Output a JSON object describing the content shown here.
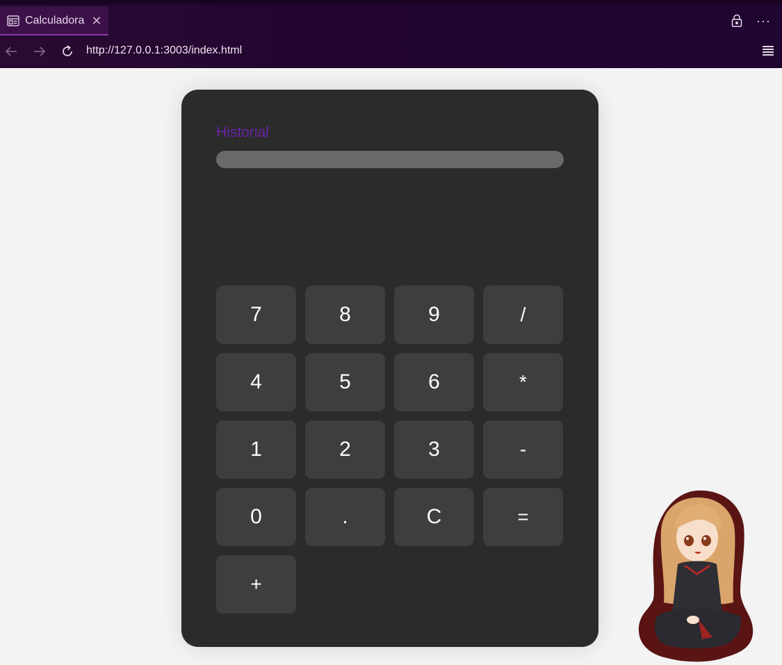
{
  "browser": {
    "tab_title": "Calculadora",
    "tab_close": "✕",
    "url": "http://127.0.0.1:3003/index.html",
    "more": "···"
  },
  "calculator": {
    "history_label": "Historial",
    "keys": [
      {
        "label": "7"
      },
      {
        "label": "8"
      },
      {
        "label": "9"
      },
      {
        "label": "/"
      },
      {
        "label": "4"
      },
      {
        "label": "5"
      },
      {
        "label": "6"
      },
      {
        "label": "*"
      },
      {
        "label": "1"
      },
      {
        "label": "2"
      },
      {
        "label": "3"
      },
      {
        "label": "-"
      },
      {
        "label": "0"
      },
      {
        "label": "."
      },
      {
        "label": "C"
      },
      {
        "label": "="
      },
      {
        "label": "+"
      }
    ]
  },
  "colors": {
    "accent": "#6b23a8",
    "panel": "#2b2b2b",
    "key": "#3e3e3e",
    "chrome": "#220630"
  }
}
